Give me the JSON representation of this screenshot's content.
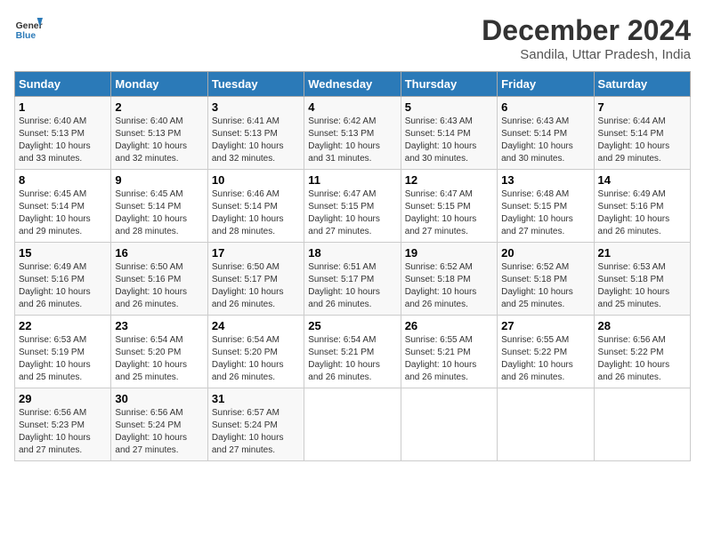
{
  "logo": {
    "line1": "General",
    "line2": "Blue"
  },
  "title": "December 2024",
  "subtitle": "Sandila, Uttar Pradesh, India",
  "weekdays": [
    "Sunday",
    "Monday",
    "Tuesday",
    "Wednesday",
    "Thursday",
    "Friday",
    "Saturday"
  ],
  "weeks": [
    [
      {
        "day": "1",
        "info": "Sunrise: 6:40 AM\nSunset: 5:13 PM\nDaylight: 10 hours\nand 33 minutes."
      },
      {
        "day": "2",
        "info": "Sunrise: 6:40 AM\nSunset: 5:13 PM\nDaylight: 10 hours\nand 32 minutes."
      },
      {
        "day": "3",
        "info": "Sunrise: 6:41 AM\nSunset: 5:13 PM\nDaylight: 10 hours\nand 32 minutes."
      },
      {
        "day": "4",
        "info": "Sunrise: 6:42 AM\nSunset: 5:13 PM\nDaylight: 10 hours\nand 31 minutes."
      },
      {
        "day": "5",
        "info": "Sunrise: 6:43 AM\nSunset: 5:14 PM\nDaylight: 10 hours\nand 30 minutes."
      },
      {
        "day": "6",
        "info": "Sunrise: 6:43 AM\nSunset: 5:14 PM\nDaylight: 10 hours\nand 30 minutes."
      },
      {
        "day": "7",
        "info": "Sunrise: 6:44 AM\nSunset: 5:14 PM\nDaylight: 10 hours\nand 29 minutes."
      }
    ],
    [
      {
        "day": "8",
        "info": "Sunrise: 6:45 AM\nSunset: 5:14 PM\nDaylight: 10 hours\nand 29 minutes."
      },
      {
        "day": "9",
        "info": "Sunrise: 6:45 AM\nSunset: 5:14 PM\nDaylight: 10 hours\nand 28 minutes."
      },
      {
        "day": "10",
        "info": "Sunrise: 6:46 AM\nSunset: 5:14 PM\nDaylight: 10 hours\nand 28 minutes."
      },
      {
        "day": "11",
        "info": "Sunrise: 6:47 AM\nSunset: 5:15 PM\nDaylight: 10 hours\nand 27 minutes."
      },
      {
        "day": "12",
        "info": "Sunrise: 6:47 AM\nSunset: 5:15 PM\nDaylight: 10 hours\nand 27 minutes."
      },
      {
        "day": "13",
        "info": "Sunrise: 6:48 AM\nSunset: 5:15 PM\nDaylight: 10 hours\nand 27 minutes."
      },
      {
        "day": "14",
        "info": "Sunrise: 6:49 AM\nSunset: 5:16 PM\nDaylight: 10 hours\nand 26 minutes."
      }
    ],
    [
      {
        "day": "15",
        "info": "Sunrise: 6:49 AM\nSunset: 5:16 PM\nDaylight: 10 hours\nand 26 minutes."
      },
      {
        "day": "16",
        "info": "Sunrise: 6:50 AM\nSunset: 5:16 PM\nDaylight: 10 hours\nand 26 minutes."
      },
      {
        "day": "17",
        "info": "Sunrise: 6:50 AM\nSunset: 5:17 PM\nDaylight: 10 hours\nand 26 minutes."
      },
      {
        "day": "18",
        "info": "Sunrise: 6:51 AM\nSunset: 5:17 PM\nDaylight: 10 hours\nand 26 minutes."
      },
      {
        "day": "19",
        "info": "Sunrise: 6:52 AM\nSunset: 5:18 PM\nDaylight: 10 hours\nand 26 minutes."
      },
      {
        "day": "20",
        "info": "Sunrise: 6:52 AM\nSunset: 5:18 PM\nDaylight: 10 hours\nand 25 minutes."
      },
      {
        "day": "21",
        "info": "Sunrise: 6:53 AM\nSunset: 5:18 PM\nDaylight: 10 hours\nand 25 minutes."
      }
    ],
    [
      {
        "day": "22",
        "info": "Sunrise: 6:53 AM\nSunset: 5:19 PM\nDaylight: 10 hours\nand 25 minutes."
      },
      {
        "day": "23",
        "info": "Sunrise: 6:54 AM\nSunset: 5:20 PM\nDaylight: 10 hours\nand 25 minutes."
      },
      {
        "day": "24",
        "info": "Sunrise: 6:54 AM\nSunset: 5:20 PM\nDaylight: 10 hours\nand 26 minutes."
      },
      {
        "day": "25",
        "info": "Sunrise: 6:54 AM\nSunset: 5:21 PM\nDaylight: 10 hours\nand 26 minutes."
      },
      {
        "day": "26",
        "info": "Sunrise: 6:55 AM\nSunset: 5:21 PM\nDaylight: 10 hours\nand 26 minutes."
      },
      {
        "day": "27",
        "info": "Sunrise: 6:55 AM\nSunset: 5:22 PM\nDaylight: 10 hours\nand 26 minutes."
      },
      {
        "day": "28",
        "info": "Sunrise: 6:56 AM\nSunset: 5:22 PM\nDaylight: 10 hours\nand 26 minutes."
      }
    ],
    [
      {
        "day": "29",
        "info": "Sunrise: 6:56 AM\nSunset: 5:23 PM\nDaylight: 10 hours\nand 27 minutes."
      },
      {
        "day": "30",
        "info": "Sunrise: 6:56 AM\nSunset: 5:24 PM\nDaylight: 10 hours\nand 27 minutes."
      },
      {
        "day": "31",
        "info": "Sunrise: 6:57 AM\nSunset: 5:24 PM\nDaylight: 10 hours\nand 27 minutes."
      },
      null,
      null,
      null,
      null
    ]
  ]
}
